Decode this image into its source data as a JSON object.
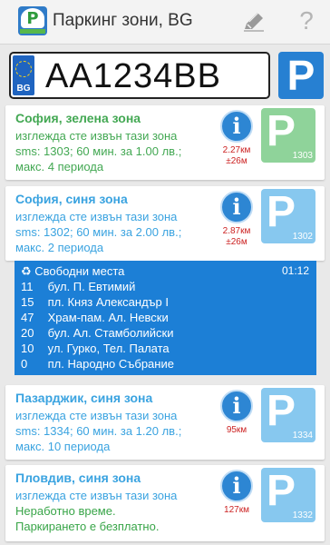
{
  "app": {
    "title": "Паркинг зони, BG",
    "help_label": "?"
  },
  "plate": {
    "country": "BG",
    "number": "AA1234BB",
    "park_label": "P"
  },
  "zones": [
    {
      "title": "София, зелена зона",
      "color": "#43a853",
      "lines": [
        "изглежда сте извън тази зона",
        "sms: 1303; 60 мин. за 1.00 лв.;",
        "макс. 4 периода"
      ],
      "distance": "2.27км",
      "accuracy": "±26м",
      "code": "1303",
      "tile_color": "#8fd39a"
    },
    {
      "title": "София, синя зона",
      "color": "#3aa3e0",
      "lines": [
        "изглежда сте извън тази зона",
        "sms: 1302; 60 мин. за 2.00 лв.;",
        "макс. 2 периода"
      ],
      "distance": "2.87км",
      "accuracy": "±26м",
      "code": "1302",
      "tile_color": "#87c8ef"
    },
    {
      "title": "Пазарджик, синя зона",
      "color": "#3aa3e0",
      "lines": [
        "изглежда сте извън тази зона",
        "sms: 1334; 60 мин. за 1.20 лв.;",
        "макс. 10 периода"
      ],
      "distance": "95км",
      "accuracy": "",
      "code": "1334",
      "tile_color": "#87c8ef"
    },
    {
      "title": "Пловдив, синя зона",
      "color": "#3aa3e0",
      "lines": [
        "изглежда сте извън тази зона",
        "Неработно време.",
        "Паркирането е безплатно."
      ],
      "distance": "127км",
      "accuracy": "",
      "code": "1332",
      "tile_color": "#87c8ef"
    }
  ],
  "free_spots": {
    "header": "♻ Свободни места",
    "time": "01:12",
    "rows": [
      {
        "count": "11",
        "place": "бул. П. Евтимий"
      },
      {
        "count": "15",
        "place": "пл. Княз Александър I"
      },
      {
        "count": "47",
        "place": "Храм-пам. Ал. Невски"
      },
      {
        "count": "20",
        "place": "бул. Ал. Стамболийски"
      },
      {
        "count": "10",
        "place": "ул. Гурко, Тел. Палата"
      },
      {
        "count": "0",
        "place": "пл. Народно Събрание"
      }
    ]
  },
  "icons": {
    "app": "parking-app-icon",
    "edit": "pencil-icon",
    "help": "question-icon",
    "info": "info-icon",
    "recycle": "recycle-icon"
  }
}
